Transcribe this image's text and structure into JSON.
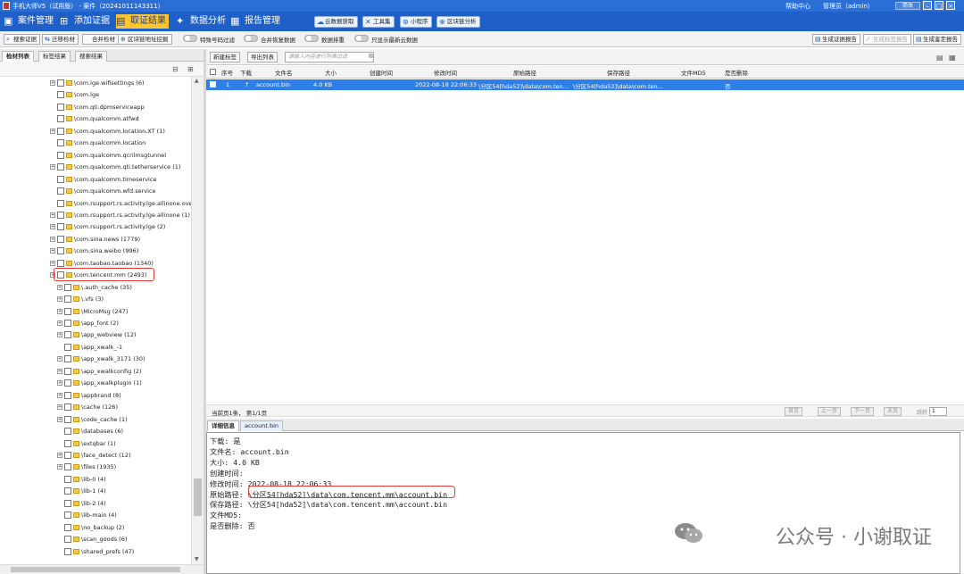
{
  "titlebar": {
    "title": "手机大师V5（试用版） - 案件（20241011143311）",
    "help": "帮助中心",
    "user": "管理员（admin）",
    "lang": "简体"
  },
  "nav": {
    "items": [
      {
        "label": "案件管理",
        "icon": "folder-icon"
      },
      {
        "label": "添加证据",
        "icon": "add-evidence-icon"
      },
      {
        "label": "取证结果",
        "icon": "result-icon"
      },
      {
        "label": "数据分析",
        "icon": "analysis-icon"
      },
      {
        "label": "报告管理",
        "icon": "report-icon"
      }
    ],
    "tools": [
      "云数据获取",
      "工具集",
      "小程序",
      "区块链分析"
    ]
  },
  "toolbar": {
    "buttons": [
      "搜索证据",
      "迁移检材",
      "合并检材",
      "区块链地址挖掘"
    ],
    "toggles": [
      "特殊号码过滤",
      "合并恢复数据",
      "数据排重",
      "只显示最新云数据"
    ],
    "right_buttons": [
      "生成证据报告",
      "生成标签报告",
      "生成鉴定报告"
    ]
  },
  "left": {
    "tabs": [
      "检材列表",
      "标签结果",
      "搜索结果"
    ],
    "tree": [
      {
        "label": "\\com.lge.wifisettings (6)",
        "exp": true,
        "lvl": 0
      },
      {
        "label": "\\com.lge",
        "exp": false,
        "lvl": 0
      },
      {
        "label": "\\com.qti.dpmserviceapp",
        "exp": false,
        "lvl": 0
      },
      {
        "label": "\\com.qualcomm.atfwd",
        "exp": false,
        "lvl": 0
      },
      {
        "label": "\\com.qualcomm.location.XT (1)",
        "exp": true,
        "lvl": 0
      },
      {
        "label": "\\com.qualcomm.location",
        "exp": false,
        "lvl": 0
      },
      {
        "label": "\\com.qualcomm.qcrilmsgtunnel",
        "exp": false,
        "lvl": 0
      },
      {
        "label": "\\com.qualcomm.qti.tetherservice (1)",
        "exp": true,
        "lvl": 0
      },
      {
        "label": "\\com.qualcomm.timeservice",
        "exp": false,
        "lvl": 0
      },
      {
        "label": "\\com.qualcomm.wfd.service",
        "exp": false,
        "lvl": 0
      },
      {
        "label": "\\com.rsupport.rs.activity.lge.allinone.overl",
        "exp": false,
        "lvl": 0
      },
      {
        "label": "\\com.rsupport.rs.activity.lge.allinone (1)",
        "exp": true,
        "lvl": 0
      },
      {
        "label": "\\com.rsupport.rs.activity.lge (2)",
        "exp": true,
        "lvl": 0
      },
      {
        "label": "\\com.sina.news (1779)",
        "exp": true,
        "lvl": 0
      },
      {
        "label": "\\com.sina.weibo (996)",
        "exp": true,
        "lvl": 0
      },
      {
        "label": "\\com.taobao.taobao (1340)",
        "exp": true,
        "lvl": 0
      },
      {
        "label": "\\com.tencent.mm (2493)",
        "exp": true,
        "lvl": 0,
        "highlight": true
      },
      {
        "label": "\\.auth_cache (35)",
        "exp": true,
        "lvl": 1
      },
      {
        "label": "\\.vfs (3)",
        "exp": true,
        "lvl": 1
      },
      {
        "label": "\\MicroMsg (247)",
        "exp": true,
        "lvl": 1
      },
      {
        "label": "\\app_font (2)",
        "exp": true,
        "lvl": 1
      },
      {
        "label": "\\app_webview (12)",
        "exp": true,
        "lvl": 1
      },
      {
        "label": "\\app_xwalk_-1",
        "exp": false,
        "lvl": 1
      },
      {
        "label": "\\app_xwalk_3171 (30)",
        "exp": true,
        "lvl": 1
      },
      {
        "label": "\\app_xwalkconfig (2)",
        "exp": true,
        "lvl": 1
      },
      {
        "label": "\\app_xwalkplugin (1)",
        "exp": true,
        "lvl": 1
      },
      {
        "label": "\\appbrand (8)",
        "exp": true,
        "lvl": 1
      },
      {
        "label": "\\cache (126)",
        "exp": true,
        "lvl": 1
      },
      {
        "label": "\\code_cache (1)",
        "exp": true,
        "lvl": 1
      },
      {
        "label": "\\databases (6)",
        "exp": false,
        "lvl": 1
      },
      {
        "label": "\\extqbar (1)",
        "exp": false,
        "lvl": 1
      },
      {
        "label": "\\face_detect (12)",
        "exp": true,
        "lvl": 1
      },
      {
        "label": "\\files (1935)",
        "exp": true,
        "lvl": 1
      },
      {
        "label": "\\lib-0 (4)",
        "exp": false,
        "lvl": 1
      },
      {
        "label": "\\lib-1 (4)",
        "exp": false,
        "lvl": 1
      },
      {
        "label": "\\lib-2 (4)",
        "exp": false,
        "lvl": 1
      },
      {
        "label": "\\lib-main (4)",
        "exp": false,
        "lvl": 1
      },
      {
        "label": "\\no_backup (2)",
        "exp": false,
        "lvl": 1
      },
      {
        "label": "\\scan_goods (6)",
        "exp": false,
        "lvl": 1
      },
      {
        "label": "\\shared_prefs (47)",
        "exp": false,
        "lvl": 1
      }
    ]
  },
  "right": {
    "new_tag": "新建标签",
    "export_list": "导出列表",
    "filter_placeholder": "请输入内容进行列表过滤",
    "columns": [
      "序号",
      "下载",
      "文件名",
      "大小",
      "创建时间",
      "修改时间",
      "原始路径",
      "保存路径",
      "文件MD5",
      "是否删除"
    ],
    "rows": [
      [
        "1",
        "↑",
        "account.bin",
        "4.0 KB",
        "",
        "2022-08-18 22:06:33",
        "\\分区54[hda52]\\data\\com.ten...",
        "\\分区54[hda52]\\data\\com.ten...",
        "",
        "否"
      ]
    ],
    "pager_text": "当前页1条， 第1/1页",
    "pager_buttons": [
      "首页",
      "上一页",
      "下一页",
      "末页"
    ],
    "goto_label": "跳转",
    "goto_value": "1",
    "detail_tabs": [
      "详细信息",
      "account.bin"
    ],
    "detail_lines": [
      "下载: 是",
      "文件名: account.bin",
      "大小: 4.0 KB",
      "创建时间:",
      "修改时间: 2022-08-18 22:06:33",
      "原始路径: \\分区54[hda52]\\data\\com.tencent.mm\\account.bin",
      "保存路径: \\分区54[hda52]\\data\\com.tencent.mm\\account.bin",
      "文件MD5:",
      "是否删除: 否"
    ]
  },
  "watermark": "公众号 · 小谢取证"
}
